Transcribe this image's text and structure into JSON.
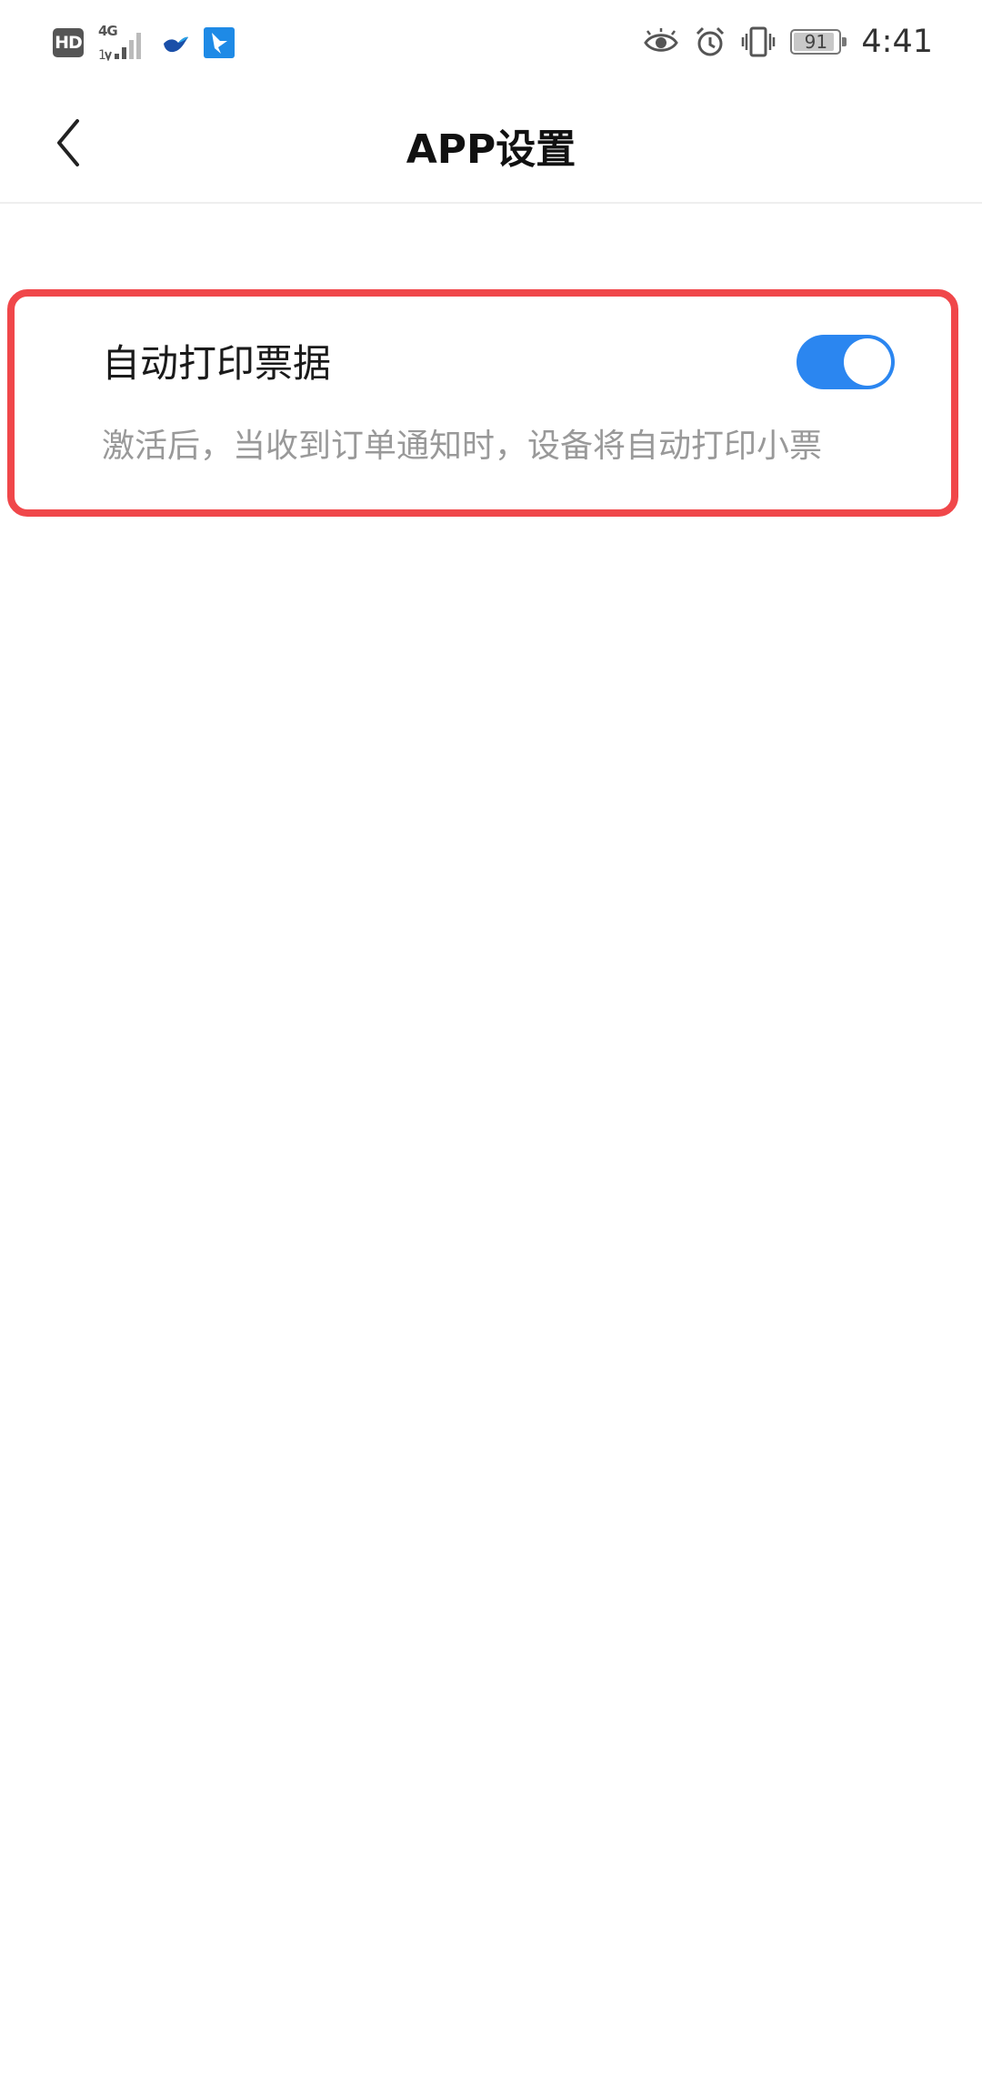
{
  "status_bar": {
    "hd_label": "HD",
    "network_label": "4G",
    "battery_percent": 91,
    "battery_label": "91",
    "time": "4:41",
    "left_icons": [
      "hd-badge",
      "signal-4g-icon",
      "bird-app-icon",
      "feishu-app-icon"
    ],
    "right_icons": [
      "eye-icon",
      "alarm-icon",
      "vibrate-icon",
      "battery-icon"
    ]
  },
  "header": {
    "title": "APP设置"
  },
  "setting": {
    "title": "自动打印票据",
    "description": "激活后，当收到订单通知时，设备将自动打印小票",
    "enabled": true
  },
  "colors": {
    "toggle_on": "#2b86f0",
    "highlight_border": "#f0474a",
    "description_text": "#999999"
  }
}
